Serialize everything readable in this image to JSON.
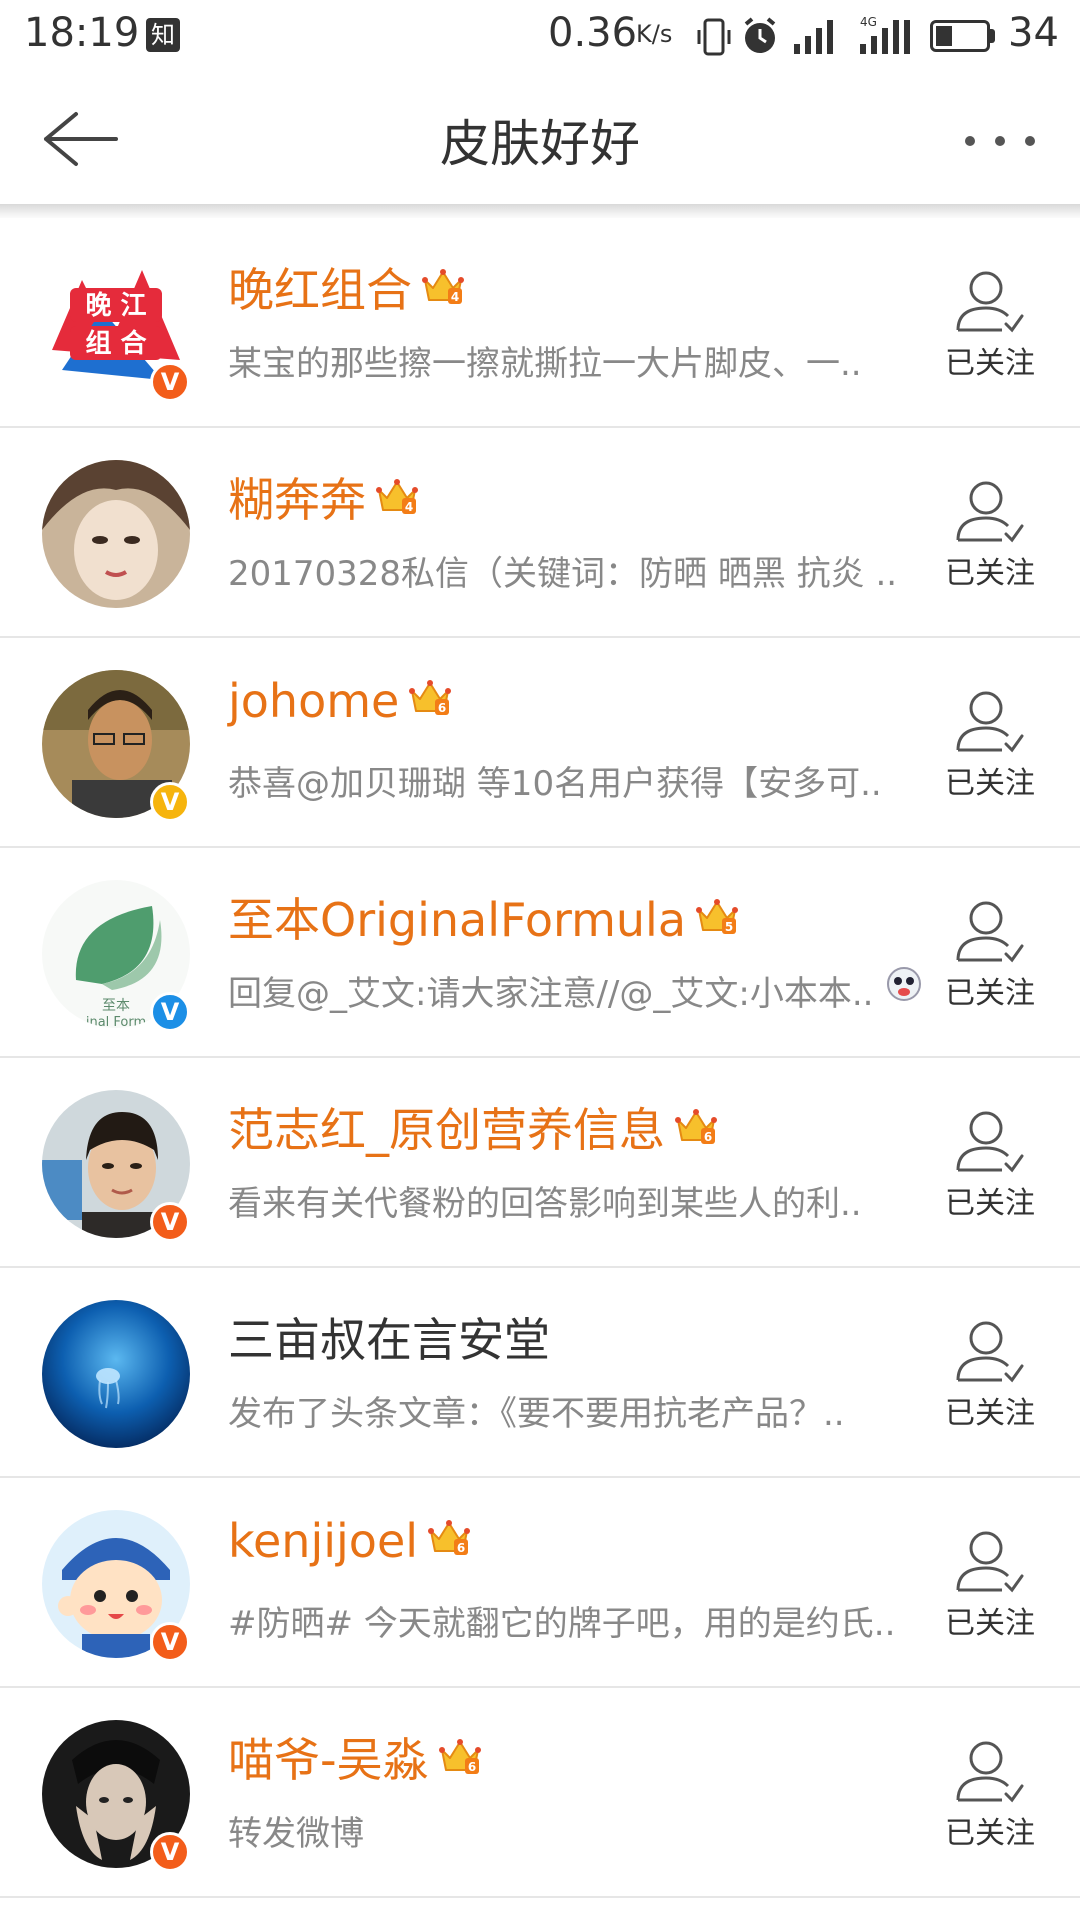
{
  "status_bar": {
    "time": "18:19",
    "app_badge": "知",
    "net_speed": "0.36",
    "net_unit": "K/s",
    "network": "4G",
    "battery": "34",
    "battery_level": 0.34
  },
  "nav": {
    "title": "皮肤好好",
    "back_icon": "back-arrow-icon",
    "more_icon": "more-dots-icon"
  },
  "colors": {
    "vip_name": "#e77216",
    "normal_name": "#333333",
    "desc": "#888888",
    "verified_red": "#f35d1a",
    "verified_yellow": "#f6b40d",
    "verified_blue": "#1c8fe6"
  },
  "follow_label": "已关注",
  "users": [
    {
      "name": "晚红组合",
      "desc": "某宝的那些擦一擦就撕拉一大片脚皮、一..",
      "vip": true,
      "crown_level": "4",
      "badge": "red",
      "avatar": "wanhong"
    },
    {
      "name": "糊奔奔",
      "desc": "20170328私信（关键词：防晒 晒黑 抗炎 ..",
      "vip": true,
      "crown_level": "4",
      "badge": null,
      "avatar": "hubenben"
    },
    {
      "name": "johome",
      "desc": "恭喜@加贝珊瑚 等10名用户获得【安多可..",
      "vip": true,
      "crown_level": "6",
      "badge": "yellow",
      "avatar": "johome"
    },
    {
      "name": "至本OriginalFormula",
      "desc": "回复@_艾文:请大家注意//@_艾文:小本本..",
      "vip": true,
      "crown_level": "5",
      "badge": "blue",
      "avatar": "zhiben"
    },
    {
      "name": "范志红_原创营养信息",
      "desc": "看来有关代餐粉的回答影响到某些人的利..",
      "vip": true,
      "crown_level": "6",
      "badge": "red",
      "avatar": "fan"
    },
    {
      "name": "三亩叔在言安堂",
      "desc": "发布了头条文章：《要不要用抗老产品？..",
      "vip": false,
      "crown_level": "",
      "badge": null,
      "avatar": "sanmu"
    },
    {
      "name": "kenjijoel",
      "desc": "#防晒# 今天就翻它的牌子吧，用的是约氏..",
      "vip": true,
      "crown_level": "6",
      "badge": "red",
      "avatar": "kenji"
    },
    {
      "name": "喵爷-吴淼",
      "desc": "转发微博",
      "vip": true,
      "crown_level": "6",
      "badge": "red",
      "avatar": "miaoye"
    }
  ]
}
